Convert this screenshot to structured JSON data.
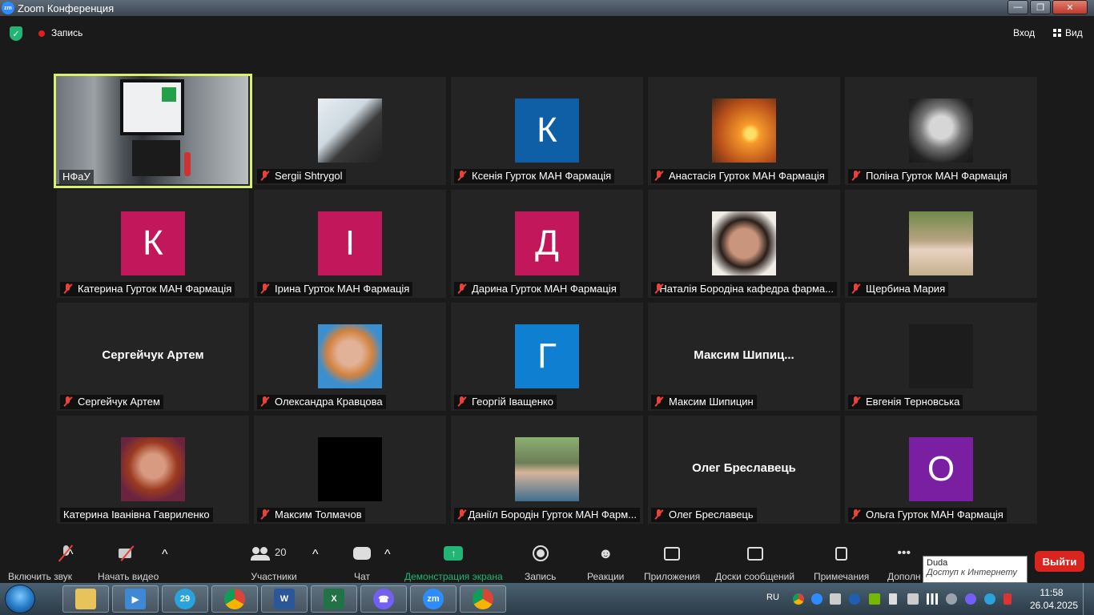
{
  "window": {
    "title": "Zoom Конференция",
    "logo_text": "zm"
  },
  "topbar": {
    "recording_label": "Запись",
    "signin_label": "Вход",
    "view_label": "Вид"
  },
  "tiles": [
    {
      "name": "НФаУ",
      "muted": false,
      "kind": "screen"
    },
    {
      "name": "Sergii Shtrygol",
      "muted": true,
      "kind": "photo",
      "photo": "ph-man"
    },
    {
      "name": "Ксенія Гурток МАН Фармація",
      "muted": true,
      "kind": "letter",
      "letter": "К",
      "color": "#0e5fa6"
    },
    {
      "name": "Анастасія Гурток МАН Фармація",
      "muted": true,
      "kind": "photo",
      "photo": "ph-sunset"
    },
    {
      "name": "Поліна Гурток МАН Фармація",
      "muted": true,
      "kind": "photo",
      "photo": "ph-bw"
    },
    {
      "name": "Катерина Гурток МАН Фармація",
      "muted": true,
      "kind": "letter",
      "letter": "К",
      "color": "#c2185b"
    },
    {
      "name": "Ірина Гурток МАН Фармація",
      "muted": true,
      "kind": "letter",
      "letter": "І",
      "color": "#c2185b"
    },
    {
      "name": "Дарина Гурток МАН Фармація",
      "muted": true,
      "kind": "letter",
      "letter": "Д",
      "color": "#c2185b"
    },
    {
      "name": "Наталія Бородіна кафедра фарма...",
      "muted": true,
      "kind": "photo",
      "photo": "ph-woman1"
    },
    {
      "name": "Щербина Мария",
      "muted": true,
      "kind": "photo",
      "photo": "ph-woman2"
    },
    {
      "name": "Сергейчук Артем",
      "muted": true,
      "kind": "name",
      "bigname": "Сергейчук Артем"
    },
    {
      "name": "Олександра Кравцова",
      "muted": true,
      "kind": "photo",
      "photo": "ph-woman3"
    },
    {
      "name": "Георгій Іващенко",
      "muted": true,
      "kind": "letter",
      "letter": "Г",
      "color": "#0f7fd1"
    },
    {
      "name": "Максим Шипицин",
      "muted": true,
      "kind": "name",
      "bigname": "Максим  Шипиц..."
    },
    {
      "name": "Евгенія Терновська",
      "muted": true,
      "kind": "photo",
      "photo": "ph-dark"
    },
    {
      "name": "Катерина Іванівна Гавриленко",
      "muted": false,
      "kind": "photo",
      "photo": "ph-woman4"
    },
    {
      "name": "Максим Толмачов",
      "muted": true,
      "kind": "photo",
      "photo": "ph-black"
    },
    {
      "name": "Даніїл Бородін Гурток МАН Фарм...",
      "muted": true,
      "kind": "photo",
      "photo": "ph-man2"
    },
    {
      "name": "Олег Бреславець",
      "muted": true,
      "kind": "name",
      "bigname": "Олег Бреславець"
    },
    {
      "name": "Ольга Гурток МАН Фармація",
      "muted": true,
      "kind": "letter",
      "letter": "О",
      "color": "#7b1fa2"
    }
  ],
  "toolbar": {
    "audio_label": "Включить звук",
    "video_label": "Начать видео",
    "participants_label": "Участники",
    "participants_count": "20",
    "chat_label": "Чат",
    "share_label": "Демонстрация экрана",
    "record_label": "Запись",
    "reactions_label": "Реакции",
    "apps_label": "Приложения",
    "whiteboards_label": "Доски сообщений",
    "notes_label": "Примечания",
    "more_label": "Дополн",
    "exit_label": "Выйти",
    "caret": "^"
  },
  "tooltip": {
    "line1": "Duda",
    "line2": "Доступ к Интернету"
  },
  "taskbar": {
    "lang": "RU",
    "time": "11:58",
    "date": "26.04.2025",
    "apps": [
      "folder-icon",
      "media-player-icon",
      "telegram-icon",
      "chrome-icon",
      "word-icon",
      "excel-icon",
      "viber-icon",
      "zoom-icon",
      "chrome-profile-icon"
    ],
    "telegram_badge": "29",
    "zoom_text": "zm",
    "word_text": "W",
    "excel_text": "X"
  }
}
